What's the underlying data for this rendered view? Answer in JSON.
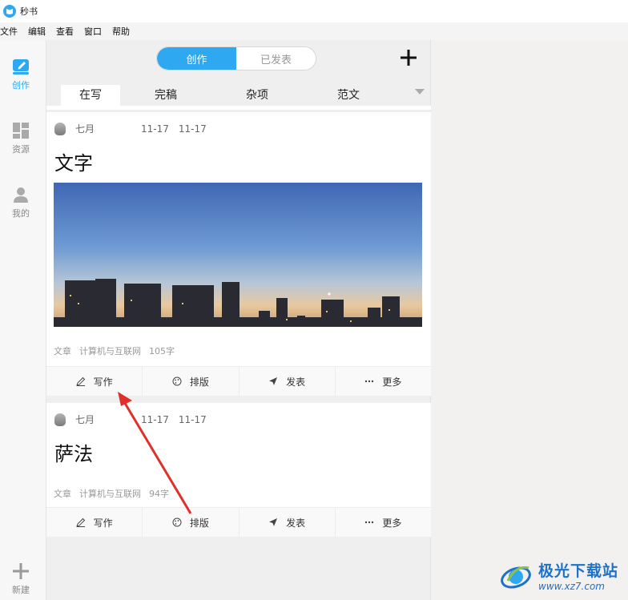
{
  "app": {
    "title": "秒书"
  },
  "menu": [
    "文件",
    "编辑",
    "查看",
    "窗口",
    "帮助"
  ],
  "sidebar": {
    "items": [
      {
        "label": "创作",
        "icon": "edit-icon",
        "active": true
      },
      {
        "label": "资源",
        "icon": "grid-icon"
      },
      {
        "label": "我的",
        "icon": "user-icon"
      }
    ],
    "new_label": "新建"
  },
  "segment": {
    "left": "创作",
    "right": "已发表"
  },
  "tabs": [
    "在写",
    "完稿",
    "杂项",
    "范文"
  ],
  "cards": [
    {
      "author": "七月",
      "created": "11-17",
      "modified": "11-17",
      "title": "文字",
      "category": "文章",
      "tag": "计算机与互联网",
      "words": "105字",
      "has_image": true
    },
    {
      "author": "七月",
      "created": "11-17",
      "modified": "11-17",
      "title": "萨法",
      "category": "文章",
      "tag": "计算机与互联网",
      "words": "94字",
      "has_image": false
    }
  ],
  "actions": {
    "write": "写作",
    "layout": "排版",
    "publish": "发表",
    "more": "更多"
  },
  "watermark": {
    "name": "极光下载站",
    "url": "www.xz7.com"
  },
  "colors": {
    "accent": "#2ea8f0",
    "arrow": "#e0302a"
  }
}
